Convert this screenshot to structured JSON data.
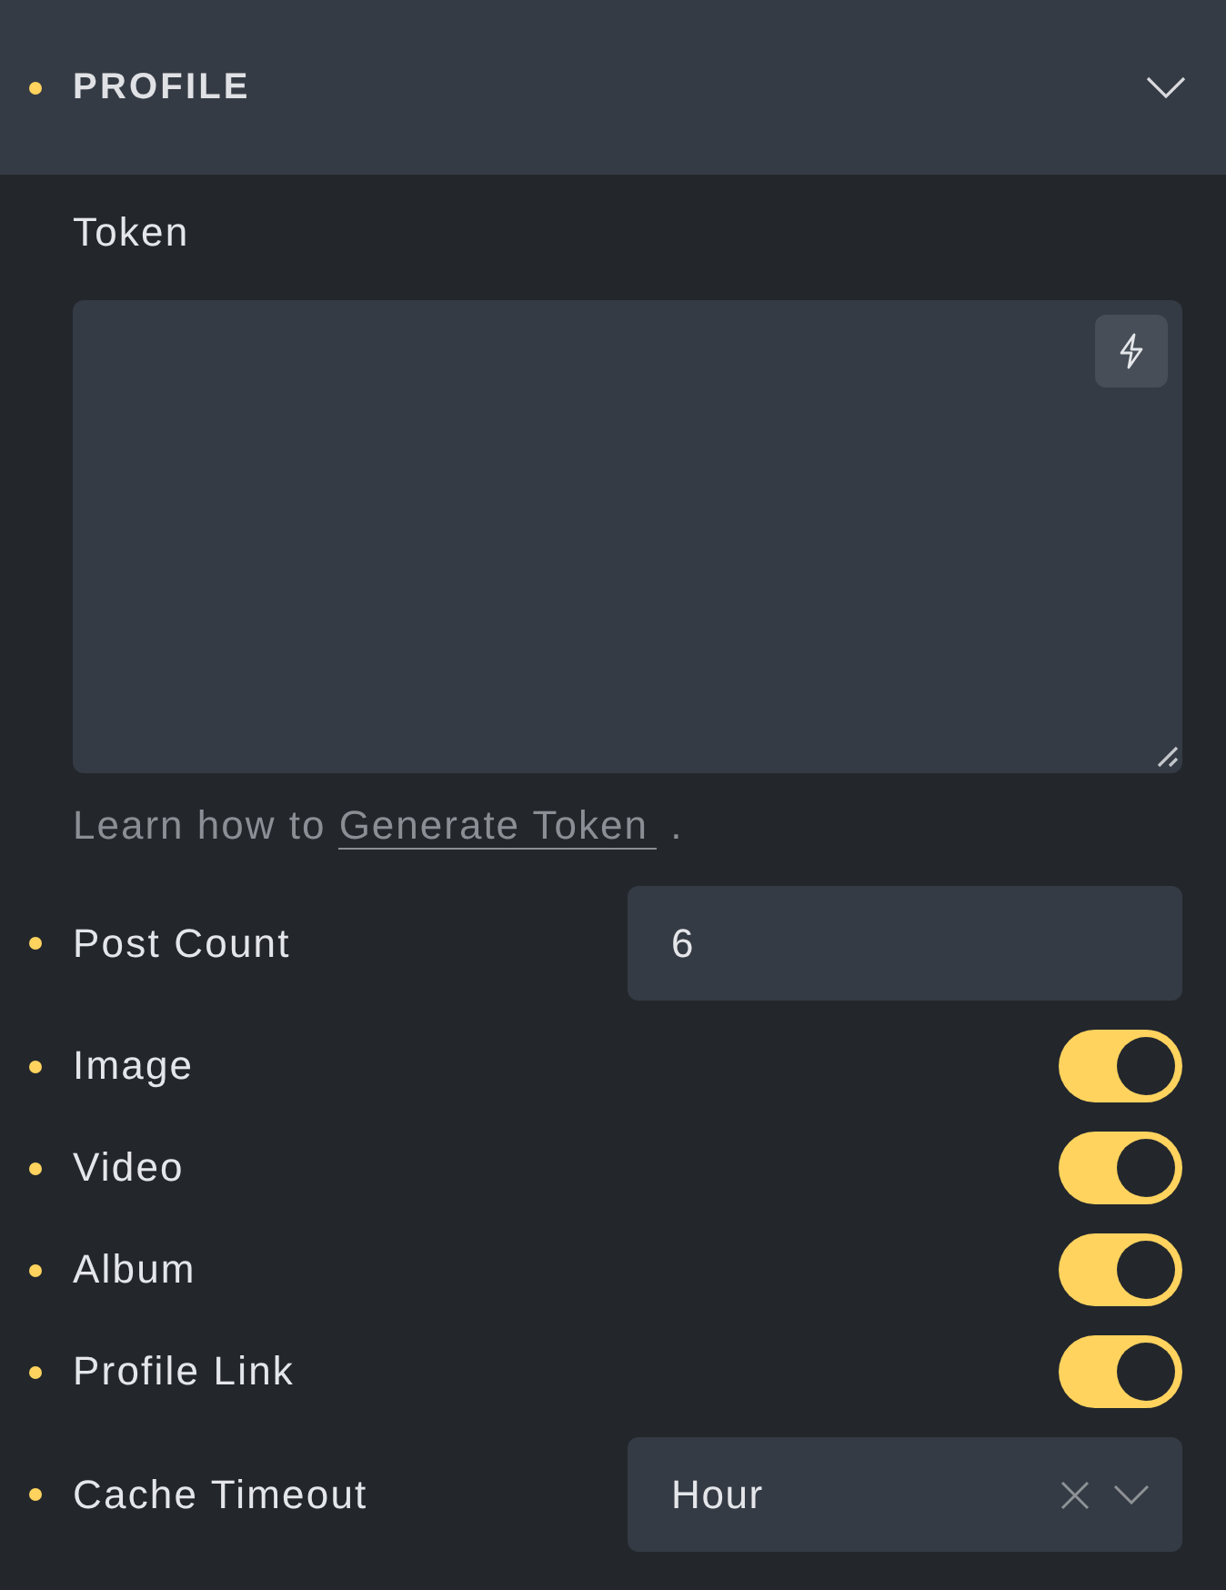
{
  "section": {
    "title": "PROFILE",
    "modified": true,
    "expanded": true
  },
  "token": {
    "label": "Token",
    "help": {
      "text": "Learn how to",
      "link": "Generate Token",
      "suffix": "."
    }
  },
  "fields": [
    {
      "kind": "number",
      "label": "Post Count",
      "modified": true,
      "value": "6"
    },
    {
      "kind": "toggle",
      "label": "Image",
      "modified": true,
      "on": true
    },
    {
      "kind": "toggle",
      "label": "Video",
      "modified": true,
      "on": true
    },
    {
      "kind": "toggle",
      "label": "Album",
      "modified": true,
      "on": true
    },
    {
      "kind": "toggle",
      "label": "Profile Link",
      "modified": true,
      "on": true
    },
    {
      "kind": "select",
      "label": "Cache Timeout",
      "modified": true,
      "value": "Hour",
      "clearable": true
    }
  ]
}
